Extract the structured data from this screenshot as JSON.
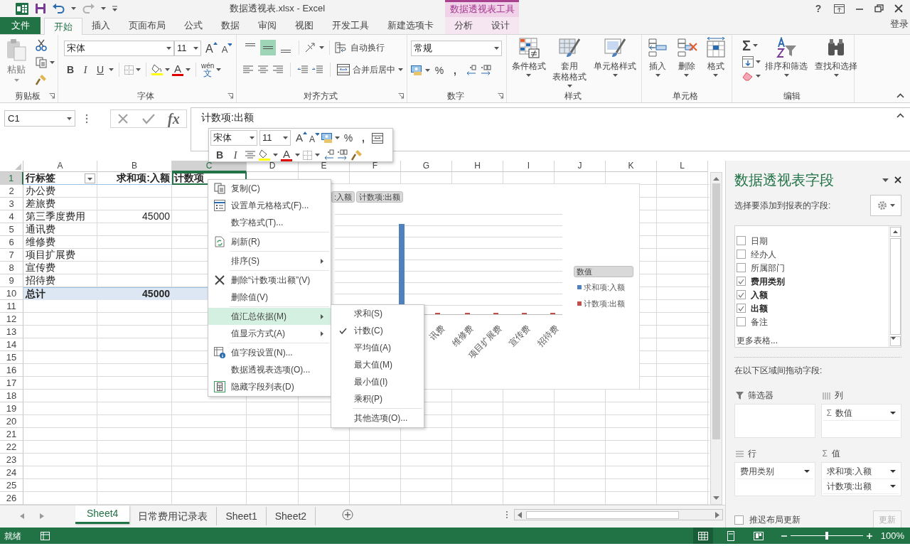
{
  "window": {
    "title": "数据透视表.xlsx - Excel",
    "help": "?",
    "sign_in": "登录"
  },
  "ribbon_tabs": {
    "file": "文件",
    "tabs": [
      {
        "label": "开始",
        "selected": true
      },
      {
        "label": "插入",
        "selected": false
      },
      {
        "label": "页面布局",
        "selected": false
      },
      {
        "label": "公式",
        "selected": false
      },
      {
        "label": "数据",
        "selected": false
      },
      {
        "label": "审阅",
        "selected": false
      },
      {
        "label": "视图",
        "selected": false
      },
      {
        "label": "开发工具",
        "selected": false
      },
      {
        "label": "新建选项卡",
        "selected": false
      }
    ],
    "contextual_title": "数据透视表工具",
    "contextual_tabs": [
      {
        "label": "分析",
        "selected": false
      },
      {
        "label": "设计",
        "selected": false
      }
    ]
  },
  "ribbon": {
    "clipboard": {
      "label": "剪贴板",
      "paste": "粘贴"
    },
    "font": {
      "label": "字体",
      "font_name": "宋体",
      "font_size": "11",
      "grow": "A",
      "shrink": "A",
      "bold": "B",
      "italic": "I",
      "underline": "U",
      "font_color": "A",
      "phonetic": "wén",
      "phonetic_char": "文"
    },
    "alignment": {
      "label": "对齐方式",
      "vertical": [
        {
          "selected": false
        },
        {
          "selected": true
        },
        {
          "selected": false
        }
      ],
      "wrap": "自动换行",
      "merge": "合并后居中"
    },
    "number": {
      "label": "数字",
      "format": "常规",
      "percent": "%",
      "comma": ","
    },
    "styles": {
      "label": "样式",
      "buttons": [
        {
          "lines": [
            "条件格式"
          ]
        },
        {
          "lines": [
            "套用",
            "表格格式"
          ]
        },
        {
          "lines": [
            "单元格样式"
          ]
        }
      ]
    },
    "cells": {
      "label": "单元格",
      "buttons": [
        {
          "lines": [
            "插入"
          ]
        },
        {
          "lines": [
            "删除"
          ]
        },
        {
          "lines": [
            "格式"
          ]
        }
      ]
    },
    "editing": {
      "label": "编辑",
      "autosum": "Σ",
      "buttons": [
        {
          "lines": [
            "排序和筛选"
          ]
        },
        {
          "lines": [
            "查找和选择"
          ]
        }
      ]
    }
  },
  "formula_bar": {
    "name_box": "C1",
    "function_glyph": "fx",
    "content": "计数项:出额"
  },
  "mini_toolbar": {
    "font_name": "宋体",
    "font_size": "11",
    "grow": "A",
    "shrink": "A",
    "percent": "%",
    "comma": ",",
    "bold": "B",
    "italic": "I",
    "font_color": "A"
  },
  "sheet": {
    "columns": [
      {
        "label": "A",
        "selected": false
      },
      {
        "label": "B",
        "selected": false
      },
      {
        "label": "C",
        "selected": true
      },
      {
        "label": "D",
        "selected": false
      },
      {
        "label": "E",
        "selected": false
      },
      {
        "label": "F",
        "selected": false
      },
      {
        "label": "G",
        "selected": false
      },
      {
        "label": "H",
        "selected": false
      },
      {
        "label": "I",
        "selected": false
      },
      {
        "label": "J",
        "selected": false
      },
      {
        "label": "K",
        "selected": false
      },
      {
        "label": "L",
        "selected": false
      }
    ],
    "rows": [
      {
        "number": "1",
        "selected": true,
        "kind": "header",
        "label": "行标签",
        "sum": "求和项:入额",
        "count": "计数项"
      },
      {
        "number": "2",
        "selected": false,
        "kind": "item",
        "label": "办公费"
      },
      {
        "number": "3",
        "selected": false,
        "kind": "item",
        "label": "差旅费"
      },
      {
        "number": "4",
        "selected": false,
        "kind": "item",
        "label": "第三季度费用",
        "sum": "45000"
      },
      {
        "number": "5",
        "selected": false,
        "kind": "item",
        "label": "通讯费"
      },
      {
        "number": "6",
        "selected": false,
        "kind": "item",
        "label": "维修费"
      },
      {
        "number": "7",
        "selected": false,
        "kind": "item",
        "label": "项目扩展费"
      },
      {
        "number": "8",
        "selected": false,
        "kind": "item",
        "label": "宣传费"
      },
      {
        "number": "9",
        "selected": false,
        "kind": "item",
        "label": "招待费"
      },
      {
        "number": "10",
        "selected": false,
        "kind": "total",
        "label": "总计",
        "sum": "45000"
      },
      {
        "number": "11",
        "selected": false
      },
      {
        "number": "12",
        "selected": false
      },
      {
        "number": "13",
        "selected": false
      },
      {
        "number": "14",
        "selected": false
      },
      {
        "number": "15",
        "selected": false
      },
      {
        "number": "16",
        "selected": false
      },
      {
        "number": "17",
        "selected": false
      },
      {
        "number": "18",
        "selected": false
      },
      {
        "number": "19",
        "selected": false
      },
      {
        "number": "20",
        "selected": false
      },
      {
        "number": "21",
        "selected": false
      },
      {
        "number": "22",
        "selected": false
      },
      {
        "number": "23",
        "selected": false
      },
      {
        "number": "24",
        "selected": false
      },
      {
        "number": "25",
        "selected": false
      },
      {
        "number": "26",
        "selected": false
      }
    ]
  },
  "chart": {
    "field_buttons": [
      ":入额",
      "计数项:出额"
    ],
    "category_labels": [
      "讯费",
      "维修费",
      "项目扩展费",
      "宣传费",
      "招待费"
    ],
    "legend": {
      "title": "数值",
      "items": [
        {
          "label": "求和项:入额",
          "color": "#4f81bd"
        },
        {
          "label": "计数项:出额",
          "color": "#c0504d"
        }
      ]
    }
  },
  "context_menu": {
    "items": [
      {
        "kind": "item",
        "label": "复制(C)",
        "selected": false
      },
      {
        "kind": "item",
        "label": "设置单元格格式(F)...",
        "selected": false
      },
      {
        "kind": "item",
        "label": "数字格式(T)...",
        "selected": false
      },
      {
        "kind": "separator"
      },
      {
        "kind": "item",
        "label": "刷新(R)",
        "selected": false
      },
      {
        "kind": "separator"
      },
      {
        "kind": "item",
        "label": "排序(S)",
        "submenu": true,
        "selected": false
      },
      {
        "kind": "separator"
      },
      {
        "kind": "item",
        "label": "删除“计数项:出额”(V)",
        "selected": false
      },
      {
        "kind": "item",
        "label": "删除值(V)",
        "selected": false
      },
      {
        "kind": "separator"
      },
      {
        "kind": "item",
        "label": "值汇总依据(M)",
        "submenu": true,
        "selected": true
      },
      {
        "kind": "item",
        "label": "值显示方式(A)",
        "submenu": true,
        "selected": false
      },
      {
        "kind": "separator"
      },
      {
        "kind": "item",
        "label": "值字段设置(N)...",
        "selected": false
      },
      {
        "kind": "item",
        "label": "数据透视表选项(O)...",
        "selected": false
      },
      {
        "kind": "item",
        "label": "隐藏字段列表(D)",
        "selected": false
      }
    ]
  },
  "submenu": {
    "items": [
      {
        "kind": "item",
        "label": "求和(S)",
        "checked": false
      },
      {
        "kind": "item",
        "label": "计数(C)",
        "checked": true
      },
      {
        "kind": "item",
        "label": "平均值(A)",
        "checked": false
      },
      {
        "kind": "item",
        "label": "最大值(M)",
        "checked": false
      },
      {
        "kind": "item",
        "label": "最小值(I)",
        "checked": false
      },
      {
        "kind": "item",
        "label": "乘积(P)",
        "checked": false
      },
      {
        "kind": "separator"
      },
      {
        "kind": "item",
        "label": "其他选项(O)...",
        "checked": false
      }
    ]
  },
  "field_pane": {
    "title": "数据透视表字段",
    "subtitle": "选择要添加到报表的字段:",
    "fields": [
      {
        "label": "日期",
        "checked": false
      },
      {
        "label": "经办人",
        "checked": false
      },
      {
        "label": "所属部门",
        "checked": false
      },
      {
        "label": "费用类别",
        "checked": true
      },
      {
        "label": "入额",
        "checked": true
      },
      {
        "label": "出额",
        "checked": true
      },
      {
        "label": "备注",
        "checked": false
      }
    ],
    "more_tables": "更多表格...",
    "areas_caption": "在以下区域间拖动字段:",
    "areas": [
      {
        "kind": "filters",
        "label": "筛选器"
      },
      {
        "kind": "columns",
        "label": "列",
        "items": [
          {
            "glyph": "Σ",
            "label": "数值"
          }
        ]
      },
      {
        "kind": "rows",
        "label": "行",
        "items": [
          {
            "label": "费用类别"
          }
        ]
      },
      {
        "kind": "values",
        "glyph": "Σ",
        "label": "值",
        "items": [
          {
            "label": "求和项:入额"
          },
          {
            "label": "计数项:出额"
          }
        ]
      }
    ],
    "defer": {
      "label": "推迟布局更新",
      "checked": false
    },
    "update": {
      "label": "更新",
      "disabled": true
    }
  },
  "sheet_tabs": [
    {
      "label": "Sheet4",
      "selected": true
    },
    {
      "label": "日常费用记录表",
      "selected": false
    },
    {
      "label": "Sheet1",
      "selected": false
    },
    {
      "label": "Sheet2",
      "selected": false
    }
  ],
  "status_bar": {
    "text": "就绪",
    "views": [
      {
        "selected": true
      },
      {
        "selected": false
      },
      {
        "selected": false
      }
    ],
    "zoom_slider": {
      "level": 0.5
    },
    "zoom": "100%"
  }
}
